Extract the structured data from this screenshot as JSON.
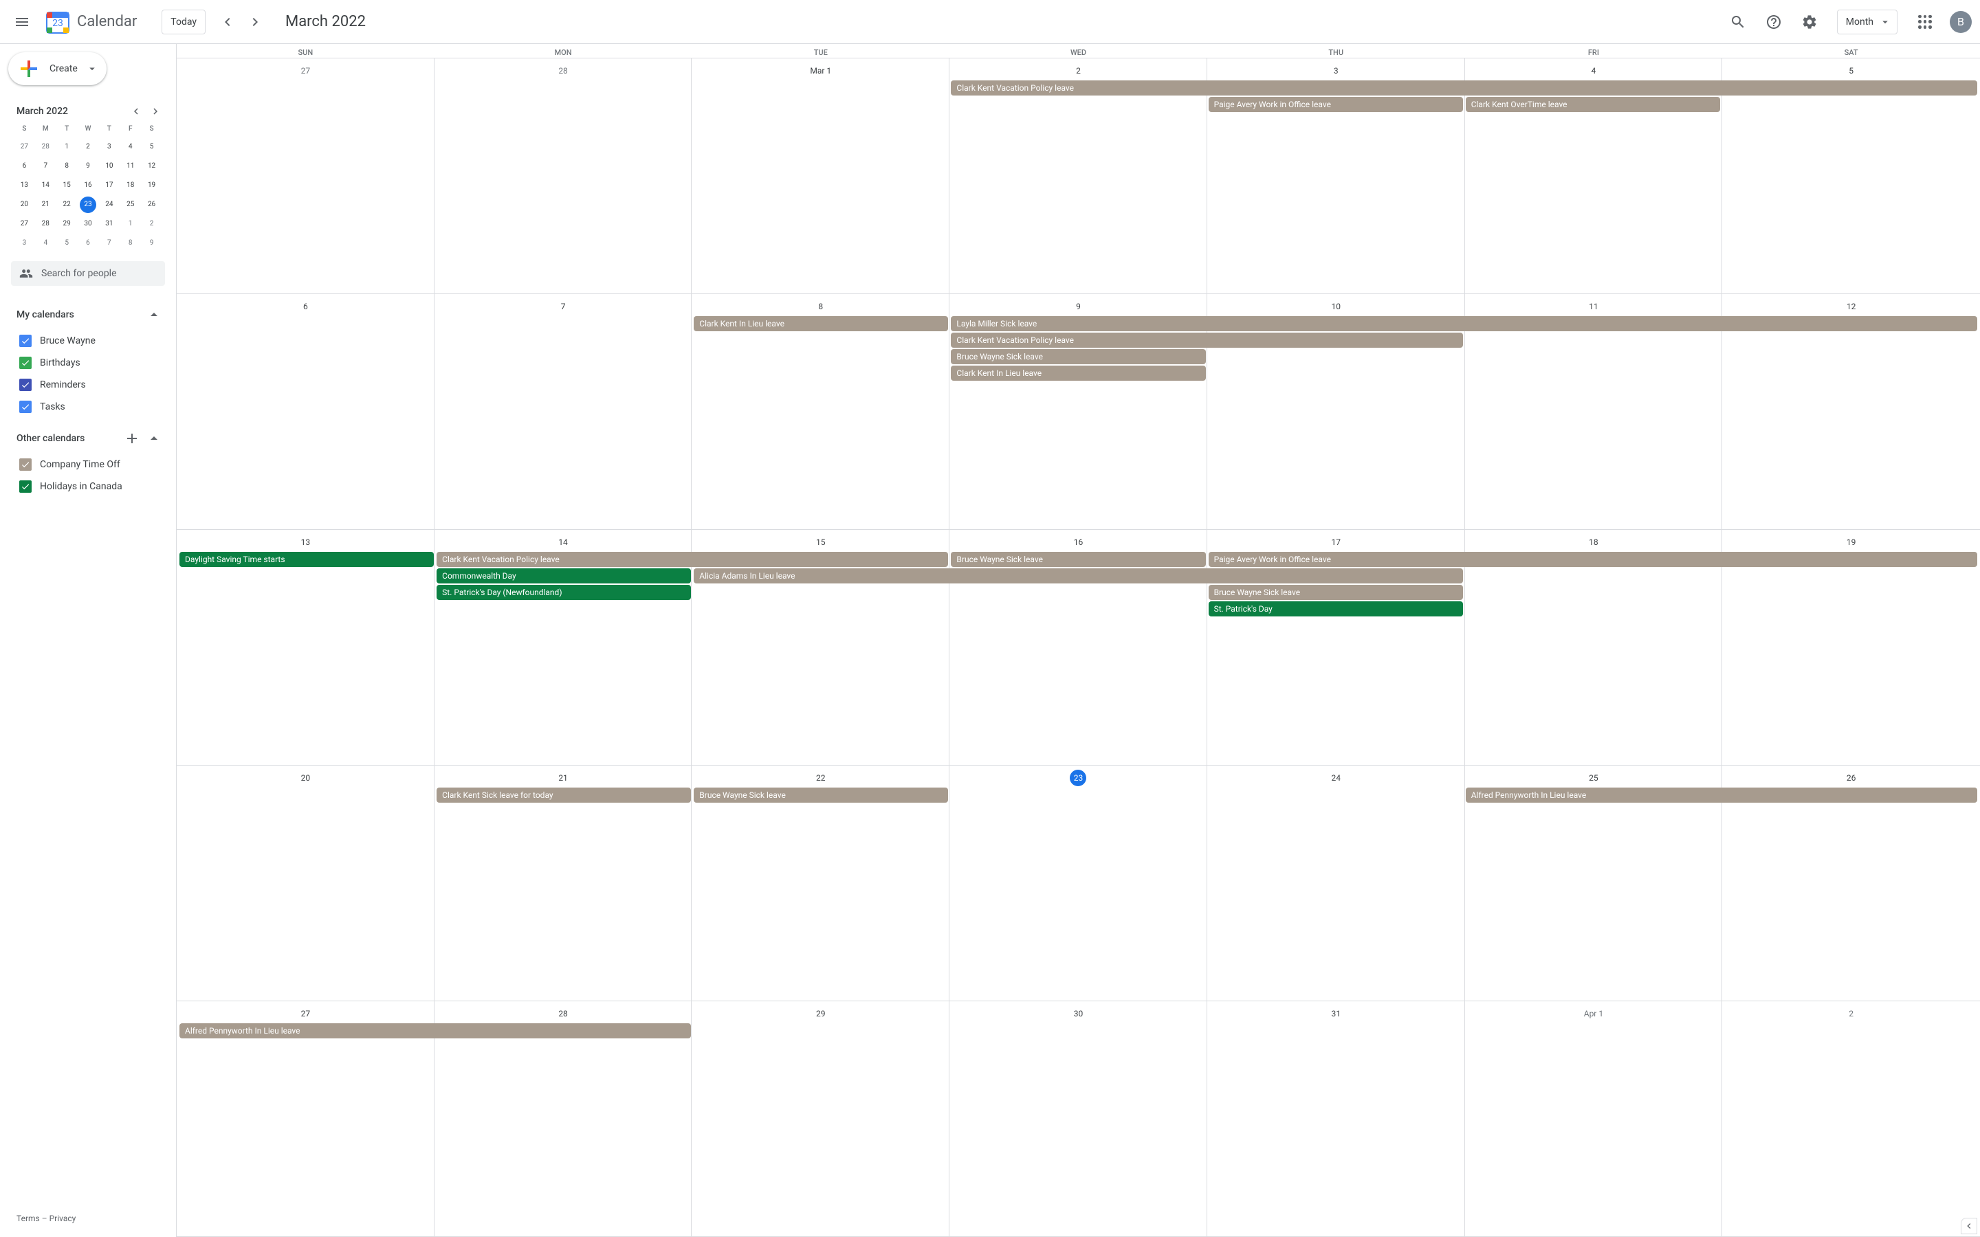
{
  "header": {
    "app_name": "Calendar",
    "logo_day": "23",
    "today_btn": "Today",
    "current_label": "March 2022",
    "view_label": "Month",
    "avatar_initial": "B"
  },
  "sidebar": {
    "create_label": "Create",
    "mini_title": "March 2022",
    "dow": [
      "S",
      "M",
      "T",
      "W",
      "T",
      "F",
      "S"
    ],
    "mini_days": [
      {
        "n": "27",
        "muted": true
      },
      {
        "n": "28",
        "muted": true
      },
      {
        "n": "1"
      },
      {
        "n": "2"
      },
      {
        "n": "3"
      },
      {
        "n": "4"
      },
      {
        "n": "5"
      },
      {
        "n": "6"
      },
      {
        "n": "7"
      },
      {
        "n": "8"
      },
      {
        "n": "9"
      },
      {
        "n": "10"
      },
      {
        "n": "11"
      },
      {
        "n": "12"
      },
      {
        "n": "13"
      },
      {
        "n": "14"
      },
      {
        "n": "15"
      },
      {
        "n": "16"
      },
      {
        "n": "17"
      },
      {
        "n": "18"
      },
      {
        "n": "19"
      },
      {
        "n": "20"
      },
      {
        "n": "21"
      },
      {
        "n": "22"
      },
      {
        "n": "23",
        "today": true
      },
      {
        "n": "24"
      },
      {
        "n": "25"
      },
      {
        "n": "26"
      },
      {
        "n": "27"
      },
      {
        "n": "28"
      },
      {
        "n": "29"
      },
      {
        "n": "30"
      },
      {
        "n": "31"
      },
      {
        "n": "1",
        "muted": true
      },
      {
        "n": "2",
        "muted": true
      },
      {
        "n": "3",
        "muted": true
      },
      {
        "n": "4",
        "muted": true
      },
      {
        "n": "5",
        "muted": true
      },
      {
        "n": "6",
        "muted": true
      },
      {
        "n": "7",
        "muted": true
      },
      {
        "n": "8",
        "muted": true
      },
      {
        "n": "9",
        "muted": true
      }
    ],
    "search_placeholder": "Search for people",
    "my_calendars_title": "My calendars",
    "my_calendars": [
      {
        "name": "Bruce Wayne",
        "color": "#4285f4",
        "checked": true
      },
      {
        "name": "Birthdays",
        "color": "#34a853",
        "checked": true
      },
      {
        "name": "Reminders",
        "color": "#3f51b5",
        "checked": true
      },
      {
        "name": "Tasks",
        "color": "#4285f4",
        "checked": true
      }
    ],
    "other_calendars_title": "Other calendars",
    "other_calendars": [
      {
        "name": "Company Time Off",
        "color": "#a79b8e",
        "checked": true
      },
      {
        "name": "Holidays in Canada",
        "color": "#0b8043",
        "checked": true
      }
    ],
    "footer": {
      "terms": "Terms",
      "sep": " – ",
      "privacy": "Privacy"
    }
  },
  "grid": {
    "dow": [
      "SUN",
      "MON",
      "TUE",
      "WED",
      "THU",
      "FRI",
      "SAT"
    ],
    "weeks": [
      {
        "dates": [
          {
            "label": "27",
            "muted": true
          },
          {
            "label": "28",
            "muted": true
          },
          {
            "label": "Mar 1"
          },
          {
            "label": "2"
          },
          {
            "label": "3"
          },
          {
            "label": "4"
          },
          {
            "label": "5"
          }
        ],
        "events": [
          {
            "title": "Clark Kent Vacation Policy leave",
            "type": "leave",
            "row": 1,
            "start": 4,
            "span": 4
          },
          {
            "title": "Paige Avery Work in Office leave",
            "type": "leave",
            "row": 2,
            "start": 5,
            "span": 1
          },
          {
            "title": "Clark Kent OverTime leave",
            "type": "leave",
            "row": 2,
            "start": 6,
            "span": 1
          }
        ]
      },
      {
        "dates": [
          {
            "label": "6"
          },
          {
            "label": "7"
          },
          {
            "label": "8"
          },
          {
            "label": "9"
          },
          {
            "label": "10"
          },
          {
            "label": "11"
          },
          {
            "label": "12"
          }
        ],
        "events": [
          {
            "title": "Clark Kent In Lieu leave",
            "type": "leave",
            "row": 1,
            "start": 3,
            "span": 1
          },
          {
            "title": "Layla Miller Sick leave",
            "type": "leave",
            "row": 1,
            "start": 4,
            "span": 4
          },
          {
            "title": "Clark Kent Vacation Policy leave",
            "type": "leave",
            "row": 2,
            "start": 4,
            "span": 2
          },
          {
            "title": "Bruce Wayne Sick leave",
            "type": "leave",
            "row": 3,
            "start": 4,
            "span": 1
          },
          {
            "title": "Clark Kent In Lieu leave",
            "type": "leave",
            "row": 4,
            "start": 4,
            "span": 1
          }
        ]
      },
      {
        "dates": [
          {
            "label": "13"
          },
          {
            "label": "14"
          },
          {
            "label": "15"
          },
          {
            "label": "16"
          },
          {
            "label": "17"
          },
          {
            "label": "18"
          },
          {
            "label": "19"
          }
        ],
        "events": [
          {
            "title": "Daylight Saving Time starts",
            "type": "holiday",
            "row": 1,
            "start": 1,
            "span": 1
          },
          {
            "title": "Clark Kent Vacation Policy leave",
            "type": "leave",
            "row": 1,
            "start": 2,
            "span": 2
          },
          {
            "title": "Bruce Wayne Sick leave",
            "type": "leave",
            "row": 1,
            "start": 4,
            "span": 1
          },
          {
            "title": "Paige Avery Work in Office leave",
            "type": "leave",
            "row": 1,
            "start": 5,
            "span": 3
          },
          {
            "title": "Commonwealth Day",
            "type": "holiday",
            "row": 2,
            "start": 2,
            "span": 1
          },
          {
            "title": "Alicia Adams In Lieu leave",
            "type": "leave",
            "row": 2,
            "start": 3,
            "span": 3
          },
          {
            "title": "St. Patrick's Day (Newfoundland)",
            "type": "holiday",
            "row": 3,
            "start": 2,
            "span": 1
          },
          {
            "title": "Bruce Wayne Sick leave",
            "type": "leave",
            "row": 3,
            "start": 5,
            "span": 1
          },
          {
            "title": "St. Patrick's Day",
            "type": "holiday",
            "row": 4,
            "start": 5,
            "span": 1
          }
        ]
      },
      {
        "dates": [
          {
            "label": "20"
          },
          {
            "label": "21"
          },
          {
            "label": "22"
          },
          {
            "label": "23",
            "today": true
          },
          {
            "label": "24"
          },
          {
            "label": "25"
          },
          {
            "label": "26"
          }
        ],
        "events": [
          {
            "title": "Clark Kent Sick leave for today",
            "type": "leave",
            "row": 1,
            "start": 2,
            "span": 1
          },
          {
            "title": "Bruce Wayne Sick leave",
            "type": "leave",
            "row": 1,
            "start": 3,
            "span": 1
          },
          {
            "title": "Alfred Pennyworth In Lieu leave",
            "type": "leave",
            "row": 1,
            "start": 6,
            "span": 2
          }
        ]
      },
      {
        "dates": [
          {
            "label": "27"
          },
          {
            "label": "28"
          },
          {
            "label": "29"
          },
          {
            "label": "30"
          },
          {
            "label": "31"
          },
          {
            "label": "Apr 1",
            "muted": true
          },
          {
            "label": "2",
            "muted": true
          }
        ],
        "events": [
          {
            "title": "Alfred Pennyworth In Lieu leave",
            "type": "leave",
            "row": 1,
            "start": 1,
            "span": 2
          }
        ]
      }
    ]
  }
}
